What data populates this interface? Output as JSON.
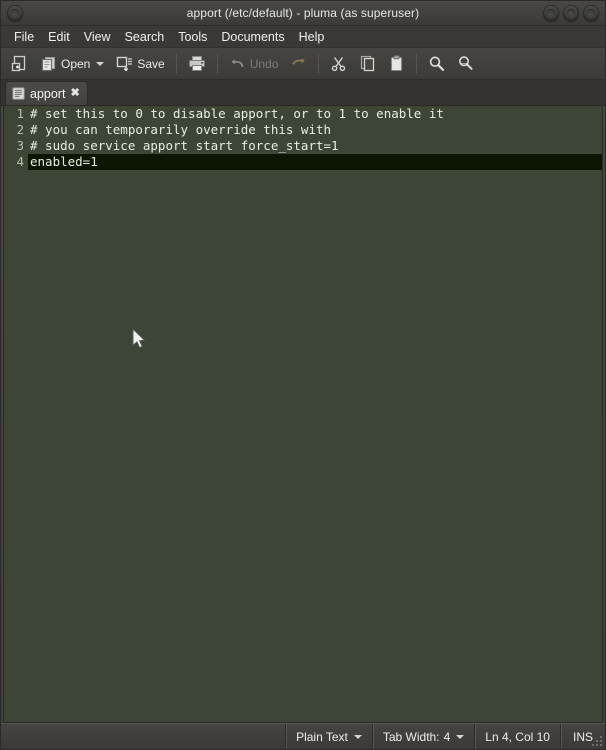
{
  "window": {
    "title": "apport (/etc/default) - pluma (as superuser)",
    "menu_icon": "window-menu-icon",
    "controls": [
      {
        "name": "minimize-button",
        "icon": "minimize-icon"
      },
      {
        "name": "maximize-button",
        "icon": "maximize-icon"
      },
      {
        "name": "close-button",
        "icon": "close-icon"
      }
    ]
  },
  "menubar": {
    "items": [
      {
        "label": "File"
      },
      {
        "label": "Edit"
      },
      {
        "label": "View"
      },
      {
        "label": "Search"
      },
      {
        "label": "Tools"
      },
      {
        "label": "Documents"
      },
      {
        "label": "Help"
      }
    ]
  },
  "toolbar": {
    "new_label": "",
    "open_label": "Open",
    "save_label": "Save",
    "print_label": "",
    "undo_label": "Undo",
    "redo_label": "",
    "cut_label": "",
    "copy_label": "",
    "paste_label": "",
    "find_label": "",
    "replace_label": ""
  },
  "tabs": [
    {
      "label": "apport",
      "icon": "document-icon",
      "close": "✖",
      "active": true
    }
  ],
  "editor": {
    "lines": [
      {
        "number": "1",
        "text": "# set this to 0 to disable apport, or to 1 to enable it",
        "current": false
      },
      {
        "number": "2",
        "text": "# you can temporarily override this with",
        "current": false
      },
      {
        "number": "3",
        "text": "# sudo service apport start force_start=1",
        "current": false
      },
      {
        "number": "4",
        "text": "enabled=1",
        "current": true
      }
    ],
    "background_color": "#3d4636",
    "current_line_color": "#0d1503",
    "text_color": "#e9ece3",
    "gutter_color": "#b9bfb0"
  },
  "statusbar": {
    "language": "Plain Text",
    "tab_width_label": "Tab Width:",
    "tab_width_value": "4",
    "position": "Ln 4, Col 10",
    "insert_mode": "INS"
  }
}
